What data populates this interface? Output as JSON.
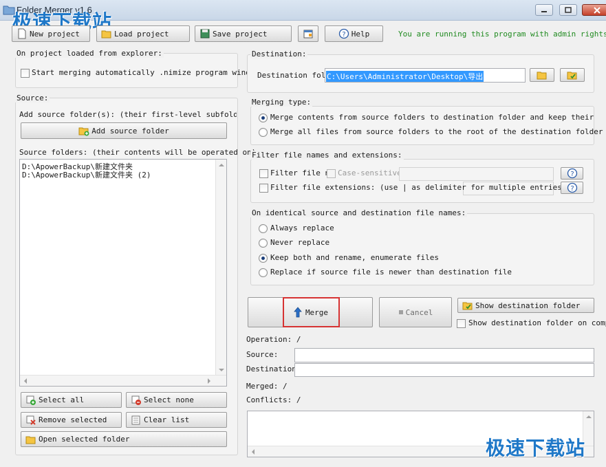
{
  "window": {
    "title": "Folder Merger v1.6",
    "watermark_text": "极速下载站"
  },
  "toolbar": {
    "new_project": "New project",
    "load_project": "Load project",
    "save_project": "Save project",
    "help": "Help",
    "admin_notice": "You are running this program with admin rights."
  },
  "explorer_group": {
    "label": "On project loaded from explorer:",
    "checkbox_label": "Start merging automatically .nimize program window"
  },
  "source_group": {
    "label": "Source:",
    "add_hint": "Add source folder(s): (their first-level subfolders w",
    "add_button": "Add source folder",
    "folders_label": "Source folders: (their contents will be operated on)",
    "folders": [
      "D:\\ApowerBackup\\新建文件夹",
      "D:\\ApowerBackup\\新建文件夹 (2)"
    ],
    "select_all": "Select all",
    "select_none": "Select none",
    "remove_selected": "Remove selected",
    "clear_list": "Clear list",
    "open_selected": "Open selected folder"
  },
  "destination_group": {
    "label": "Destination:",
    "field_label": "Destination fold",
    "field_value": "C:\\Users\\Administrator\\Desktop\\导出"
  },
  "merging_type": {
    "label": "Merging type:",
    "options": [
      "Merge contents from source folders to destination folder and keep their folder",
      "Merge all files from source folders to the root of the destination folder"
    ],
    "selected_index": 0
  },
  "filter_group": {
    "label": "Filter file names and extensions:",
    "filter_names": "Filter file n",
    "case_sensitive": "Case-sensitive",
    "filter_ext": "Filter file extensions: (use | as delimiter for multiple entries)",
    "help_glyph": "?"
  },
  "identical_group": {
    "label": "On identical source and destination file names:",
    "options": [
      "Always replace",
      "Never replace",
      "Keep both and rename, enumerate files",
      "Replace if source file is newer than destination file"
    ],
    "selected_index": 2
  },
  "actions": {
    "merge": "Merge",
    "cancel": "Cancel",
    "show_destination": "Show destination folder",
    "show_on_complete": "Show destination folder on comple"
  },
  "status": {
    "operation": "Operation: /",
    "source_label": "Source:",
    "destination_label": "Destination:",
    "merged": "Merged: /",
    "conflicts": "Conflicts: /"
  },
  "colors": {
    "accent": "#1f78c8",
    "admin_text": "#1f8a1f",
    "highlight_border": "#d63232",
    "selection": "#3399ff"
  }
}
